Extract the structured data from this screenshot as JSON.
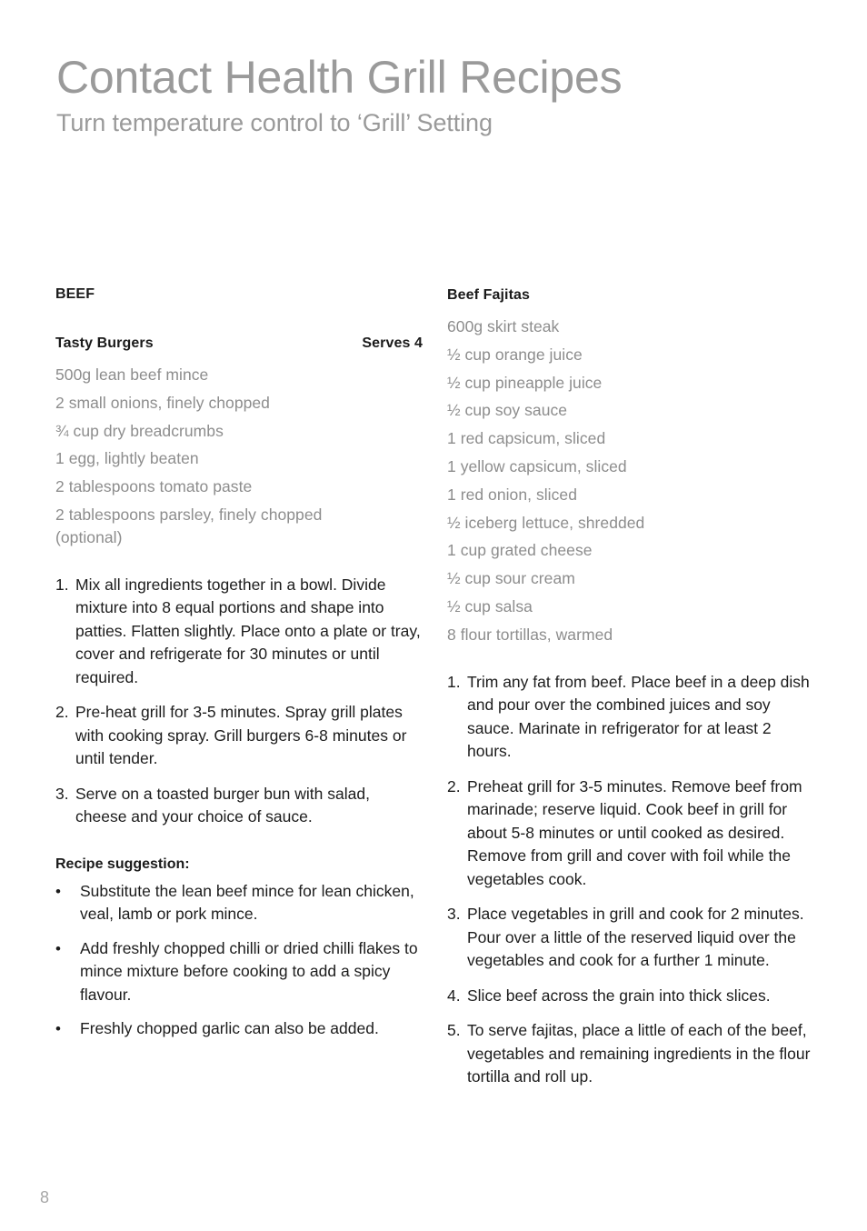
{
  "document": {
    "title": "Contact Health Grill Recipes",
    "subtitle": "Turn temperature control to ‘Grill’ Setting",
    "page_number": "8",
    "colors": {
      "heading_gray": "#9a9a9a",
      "ingredient_gray": "#8d8d8d",
      "body_black": "#1c1c1c",
      "folio_gray": "#a6a6a6",
      "page_background": "#ffffff"
    }
  },
  "left_column": {
    "section_heading": "BEEF",
    "recipe": {
      "title": "Tasty Burgers",
      "serves": "Serves 4",
      "ingredients": [
        "500g lean beef mince",
        "2 small onions, finely chopped",
        "¾ cup dry breadcrumbs",
        "1 egg, lightly beaten",
        "2 tablespoons tomato paste",
        "2 tablespoons parsley, finely chopped",
        "(optional)"
      ],
      "method": [
        {
          "num": "1.",
          "text": "Mix all ingredients together in a bowl. Divide mixture into 8 equal portions and shape into patties. Flatten slightly. Place onto a plate or tray, cover and refrigerate for 30 minutes or until required."
        },
        {
          "num": "2.",
          "text": "Pre-heat grill for 3-5 minutes. Spray grill plates with cooking spray. Grill burgers 6-8 minutes or until tender."
        },
        {
          "num": "3.",
          "text": "Serve on a toasted burger bun with salad, cheese and your choice of sauce."
        }
      ],
      "suggestion_heading": "Recipe suggestion:",
      "suggestions": [
        "Substitute the lean beef mince for lean chicken, veal, lamb or pork mince.",
        "Add freshly chopped chilli or dried chilli flakes to mince mixture before cooking to add a spicy flavour.",
        "Freshly chopped garlic can also be added."
      ],
      "bullet_glyph": "•"
    }
  },
  "right_column": {
    "recipe": {
      "title": "Beef Fajitas",
      "ingredients": [
        "600g skirt steak",
        "½ cup orange juice",
        "½ cup pineapple juice",
        "½ cup soy sauce",
        "1 red capsicum, sliced",
        "1 yellow capsicum, sliced",
        "1 red onion, sliced",
        "½ iceberg lettuce, shredded",
        "1 cup grated cheese",
        "½ cup sour cream",
        "½ cup salsa",
        "8 flour tortillas, warmed"
      ],
      "method": [
        {
          "num": "1.",
          "text": "Trim any fat from beef.  Place beef in a deep dish and pour over the combined juices and soy sauce.  Marinate in refrigerator for at least 2 hours."
        },
        {
          "num": "2.",
          "text": "Preheat grill for 3-5 minutes.  Remove beef from marinade; reserve liquid.  Cook beef in grill for about 5-8 minutes or until cooked as desired. Remove from grill and cover with foil while the vegetables cook."
        },
        {
          "num": "3.",
          "text": "Place vegetables in grill and cook for 2 minutes.  Pour over a little of the reserved liquid over the vegetables and cook for a further 1 minute."
        },
        {
          "num": "4.",
          "text": "Slice beef across the grain into thick slices."
        },
        {
          "num": "5.",
          "text": "To serve fajitas, place a little of each of the beef, vegetables and remaining ingredients in the flour tortilla and roll up."
        }
      ]
    }
  }
}
